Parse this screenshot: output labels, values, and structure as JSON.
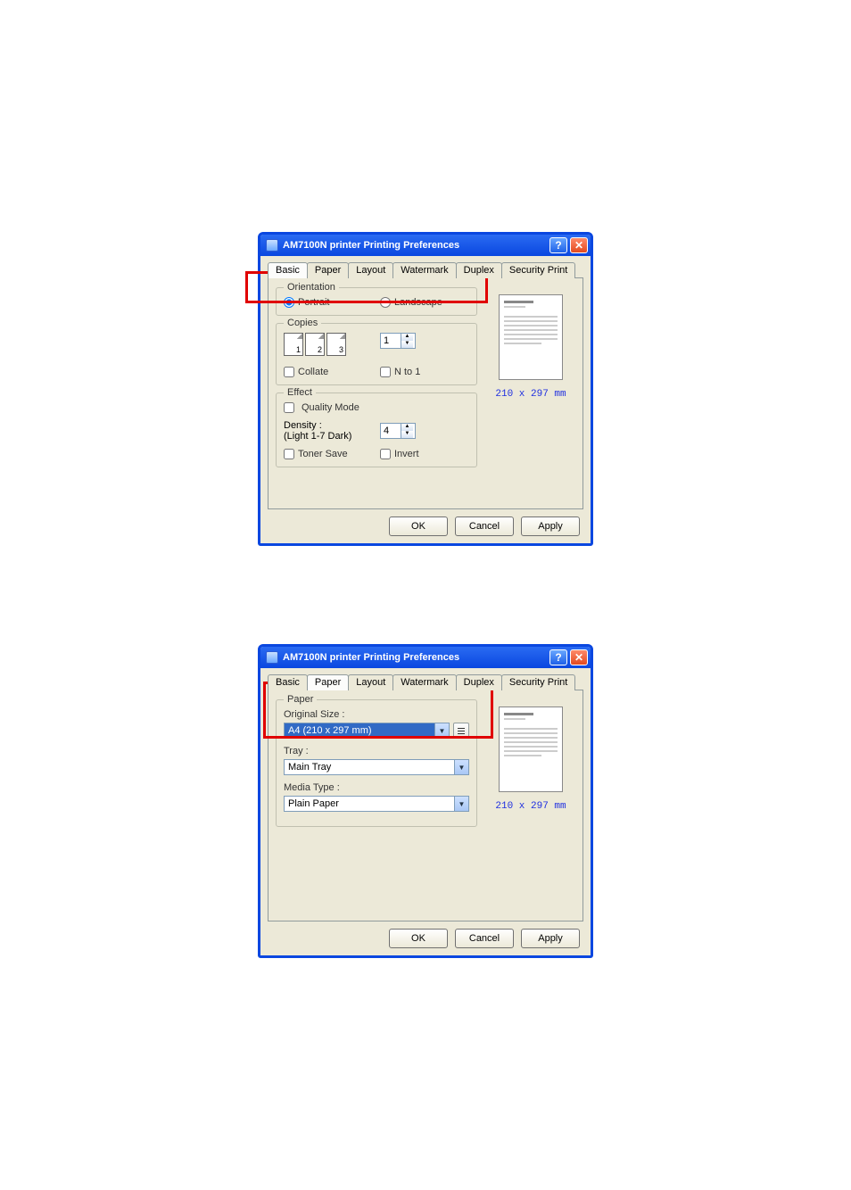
{
  "dialog1": {
    "title": "AM7100N printer Printing Preferences",
    "tabs": [
      "Basic",
      "Paper",
      "Layout",
      "Watermark",
      "Duplex",
      "Security Print"
    ],
    "active_tab": 0,
    "orientation": {
      "legend": "Orientation",
      "portrait": "Portrait",
      "landscape": "Landscape",
      "selected": "portrait"
    },
    "copies": {
      "legend": "Copies",
      "count": "1",
      "collate": "Collate",
      "nto1": "N to 1"
    },
    "effect": {
      "legend": "Effect",
      "quality": "Quality Mode",
      "density_label": "Density :",
      "density_sub": "(Light 1-7 Dark)",
      "density_value": "4",
      "toner": "Toner Save",
      "invert": "Invert"
    },
    "preview_dims": "210 x 297 mm",
    "buttons": {
      "ok": "OK",
      "cancel": "Cancel",
      "apply": "Apply"
    }
  },
  "dialog2": {
    "title": "AM7100N printer Printing Preferences",
    "tabs": [
      "Basic",
      "Paper",
      "Layout",
      "Watermark",
      "Duplex",
      "Security Print"
    ],
    "active_tab": 1,
    "paper": {
      "legend": "Paper",
      "original_size_label": "Original Size :",
      "original_size_value": "A4 (210 x 297 mm)",
      "tray_label": "Tray :",
      "tray_value": "Main Tray",
      "media_label": "Media Type :",
      "media_value": "Plain Paper"
    },
    "preview_dims": "210 x 297 mm",
    "buttons": {
      "ok": "OK",
      "cancel": "Cancel",
      "apply": "Apply"
    }
  }
}
